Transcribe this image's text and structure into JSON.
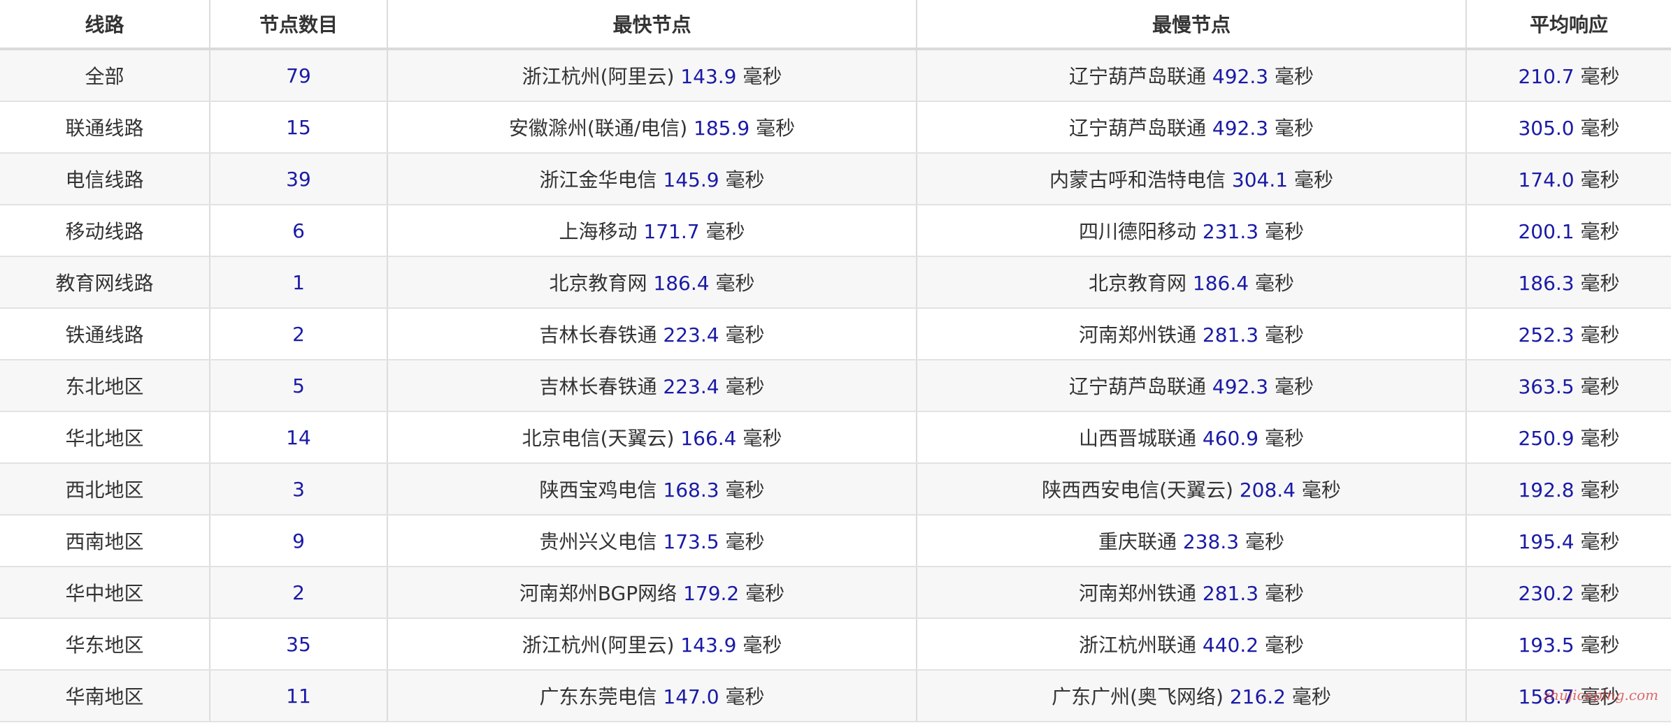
{
  "table": {
    "headers": [
      "线路",
      "节点数目",
      "最快节点",
      "最慢节点",
      "平均响应"
    ],
    "unit": "毫秒",
    "rows": [
      {
        "route": "全部",
        "count": "79",
        "fastest_name": "浙江杭州(阿里云)",
        "fastest_ms": "143.9",
        "slowest_name": "辽宁葫芦岛联通",
        "slowest_ms": "492.3",
        "avg_ms": "210.7"
      },
      {
        "route": "联通线路",
        "count": "15",
        "fastest_name": "安徽滁州(联通/电信)",
        "fastest_ms": "185.9",
        "slowest_name": "辽宁葫芦岛联通",
        "slowest_ms": "492.3",
        "avg_ms": "305.0"
      },
      {
        "route": "电信线路",
        "count": "39",
        "fastest_name": "浙江金华电信",
        "fastest_ms": "145.9",
        "slowest_name": "内蒙古呼和浩特电信",
        "slowest_ms": "304.1",
        "avg_ms": "174.0"
      },
      {
        "route": "移动线路",
        "count": "6",
        "fastest_name": "上海移动",
        "fastest_ms": "171.7",
        "slowest_name": "四川德阳移动",
        "slowest_ms": "231.3",
        "avg_ms": "200.1"
      },
      {
        "route": "教育网线路",
        "count": "1",
        "fastest_name": "北京教育网",
        "fastest_ms": "186.4",
        "slowest_name": "北京教育网",
        "slowest_ms": "186.4",
        "avg_ms": "186.3"
      },
      {
        "route": "铁通线路",
        "count": "2",
        "fastest_name": "吉林长春铁通",
        "fastest_ms": "223.4",
        "slowest_name": "河南郑州铁通",
        "slowest_ms": "281.3",
        "avg_ms": "252.3"
      },
      {
        "route": "东北地区",
        "count": "5",
        "fastest_name": "吉林长春铁通",
        "fastest_ms": "223.4",
        "slowest_name": "辽宁葫芦岛联通",
        "slowest_ms": "492.3",
        "avg_ms": "363.5"
      },
      {
        "route": "华北地区",
        "count": "14",
        "fastest_name": "北京电信(天翼云)",
        "fastest_ms": "166.4",
        "slowest_name": "山西晋城联通",
        "slowest_ms": "460.9",
        "avg_ms": "250.9"
      },
      {
        "route": "西北地区",
        "count": "3",
        "fastest_name": "陕西宝鸡电信",
        "fastest_ms": "168.3",
        "slowest_name": "陕西西安电信(天翼云)",
        "slowest_ms": "208.4",
        "avg_ms": "192.8"
      },
      {
        "route": "西南地区",
        "count": "9",
        "fastest_name": "贵州兴义电信",
        "fastest_ms": "173.5",
        "slowest_name": "重庆联通",
        "slowest_ms": "238.3",
        "avg_ms": "195.4"
      },
      {
        "route": "华中地区",
        "count": "2",
        "fastest_name": "河南郑州BGP网络",
        "fastest_ms": "179.2",
        "slowest_name": "河南郑州铁通",
        "slowest_ms": "281.3",
        "avg_ms": "230.2"
      },
      {
        "route": "华东地区",
        "count": "35",
        "fastest_name": "浙江杭州(阿里云)",
        "fastest_ms": "143.9",
        "slowest_name": "浙江杭州联通",
        "slowest_ms": "440.2",
        "avg_ms": "193.5"
      },
      {
        "route": "华南地区",
        "count": "11",
        "fastest_name": "广东东莞电信",
        "fastest_ms": "147.0",
        "slowest_name": "广东广州(奥飞网络)",
        "slowest_ms": "216.2",
        "avg_ms": "158.7"
      }
    ]
  },
  "watermark": "zhujiceping.com",
  "colors": {
    "number": "#1a1aa6",
    "text": "#333333",
    "row_alt": "#f7f7f7",
    "border": "#dcdcdc",
    "watermark": "#d23c3c"
  }
}
